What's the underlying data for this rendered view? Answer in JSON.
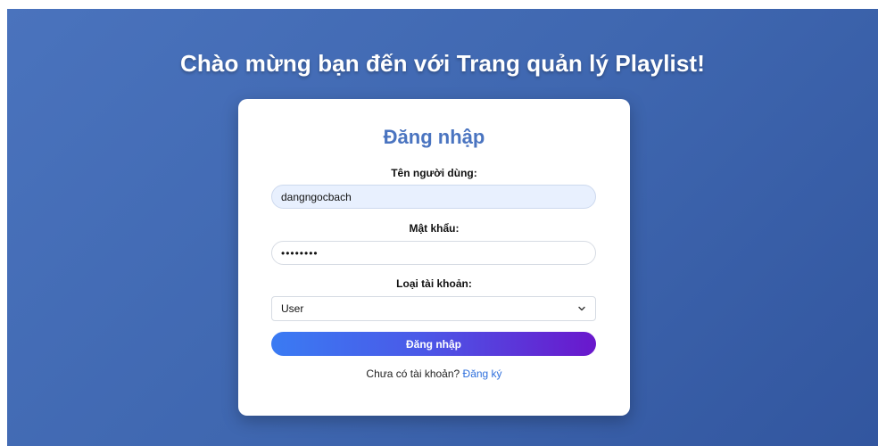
{
  "page": {
    "welcome": "Chào mừng bạn đến với Trang quản lý Playlist!"
  },
  "login": {
    "title": "Đăng nhập",
    "username_label": "Tên người dùng:",
    "username_value": "dangngocbach",
    "password_label": "Mật khẩu:",
    "password_value": "••••••••",
    "account_type_label": "Loại tài khoản:",
    "account_type_selected": "User",
    "submit_label": "Đăng nhập",
    "signup_prompt": "Chưa có tài khoản?",
    "signup_link": "Đăng ký"
  },
  "colors": {
    "background": "#4068b1",
    "title": "#4a74c0",
    "link": "#2e6fdc",
    "button_start": "#3a7bf3",
    "button_end": "#6a17cc"
  },
  "icons": {
    "select_arrow": "chevron-down-icon"
  }
}
